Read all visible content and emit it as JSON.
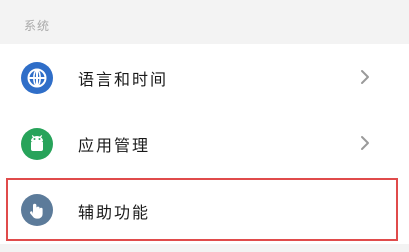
{
  "section": {
    "title": "系统"
  },
  "settings": {
    "items": [
      {
        "label": "语言和时间",
        "icon": "globe-icon",
        "icon_color": "#2f6ec8"
      },
      {
        "label": "应用管理",
        "icon": "android-icon",
        "icon_color": "#27a35a"
      },
      {
        "label": "辅助功能",
        "icon": "hand-icon",
        "icon_color": "#5c7b9a",
        "highlighted": true
      }
    ]
  },
  "colors": {
    "background": "#f3f3f3",
    "card": "#ffffff",
    "highlight_border": "#e04b4b",
    "chevron": "#9a9a9a"
  }
}
